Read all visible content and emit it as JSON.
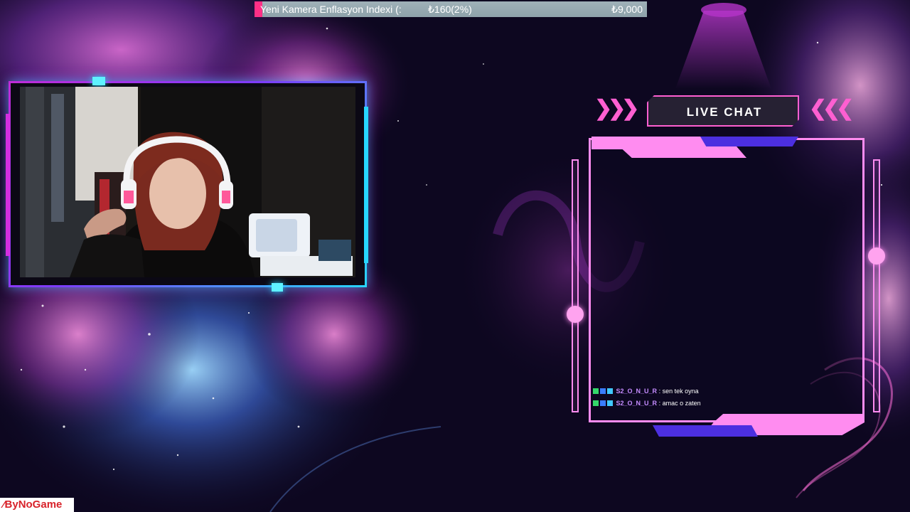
{
  "goal": {
    "label": "Yeni Kamera Enflasyon Indexi (:",
    "current": "₺160(2%)",
    "target": "₺9,000",
    "progress_fraction": 0.02
  },
  "webcam": {
    "frame_colors": [
      "#c12bd8",
      "#7d3cff",
      "#27d6ff"
    ]
  },
  "chat": {
    "title": "LIVE CHAT",
    "accent_color": "#ff8cf0",
    "messages": [
      {
        "user": "S2_O_N_U_R",
        "separator": ":",
        "text": "sen tek oyna"
      },
      {
        "user": "S2_O_N_U_R",
        "separator": ":",
        "text": "amac o zaten"
      }
    ]
  },
  "brand": {
    "name": "ByNoGame"
  },
  "colors": {
    "background": "#0d0720",
    "magenta": "#ff2f86",
    "cyan": "#27d6ff",
    "pink": "#ff8cf0",
    "brand_red": "#d8222a"
  }
}
